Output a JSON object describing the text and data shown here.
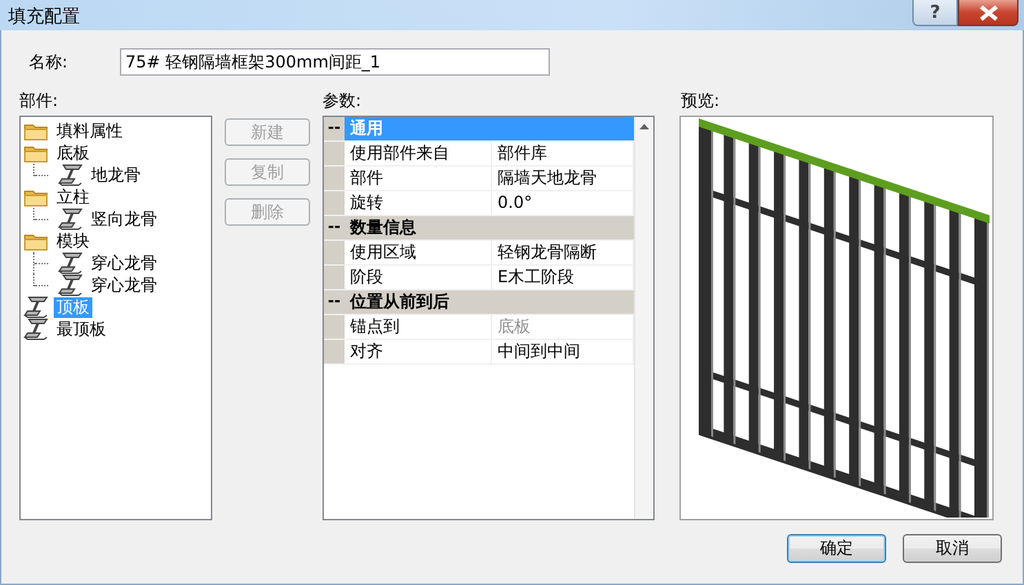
{
  "window": {
    "title": "填充配置",
    "help_button": "?"
  },
  "name_field": {
    "label": "名称:",
    "value": "75# 轻钢隔墙框架300mm间距_1"
  },
  "parts": {
    "label": "部件:",
    "tree": [
      {
        "label": "填料属性",
        "kind": "folder",
        "selected": false
      },
      {
        "label": "底板",
        "kind": "folder",
        "selected": false,
        "children": [
          {
            "label": "地龙骨",
            "kind": "part",
            "selected": false
          }
        ]
      },
      {
        "label": "立柱",
        "kind": "folder",
        "selected": false,
        "children": [
          {
            "label": "竖向龙骨",
            "kind": "part",
            "selected": false
          }
        ]
      },
      {
        "label": "模块",
        "kind": "folder",
        "selected": false,
        "children": [
          {
            "label": "穿心龙骨",
            "kind": "part",
            "selected": false
          },
          {
            "label": "穿心龙骨",
            "kind": "part",
            "selected": false
          }
        ]
      },
      {
        "label": "顶板",
        "kind": "part",
        "selected": true
      },
      {
        "label": "最顶板",
        "kind": "part",
        "selected": false
      }
    ]
  },
  "part_buttons": [
    {
      "label": "新建",
      "disabled": true
    },
    {
      "label": "复制",
      "disabled": true
    },
    {
      "label": "删除",
      "disabled": true
    }
  ],
  "parameters": {
    "label": "参数:",
    "sections": [
      {
        "toggle": "--",
        "title": "通用",
        "selected": true,
        "rows": [
          {
            "name": "使用部件来自",
            "value": "部件库",
            "disabled": false
          },
          {
            "name": "部件",
            "value": "隔墙天地龙骨",
            "disabled": false
          },
          {
            "name": "旋转",
            "value": "0.0°",
            "disabled": false
          }
        ]
      },
      {
        "toggle": "--",
        "title": "数量信息",
        "selected": false,
        "rows": [
          {
            "name": "使用区域",
            "value": "轻钢龙骨隔断",
            "disabled": false
          },
          {
            "name": "阶段",
            "value": "E木工阶段",
            "disabled": false
          }
        ]
      },
      {
        "toggle": "--",
        "title": "位置从前到后",
        "selected": false,
        "rows": [
          {
            "name": "锚点到",
            "value": "底板",
            "disabled": true
          },
          {
            "name": "对齐",
            "value": "中间到中间",
            "disabled": false
          }
        ]
      }
    ]
  },
  "preview": {
    "label": "预览:"
  },
  "buttons": [
    {
      "label": "确定",
      "default": true
    },
    {
      "label": "取消",
      "default": false
    }
  ]
}
